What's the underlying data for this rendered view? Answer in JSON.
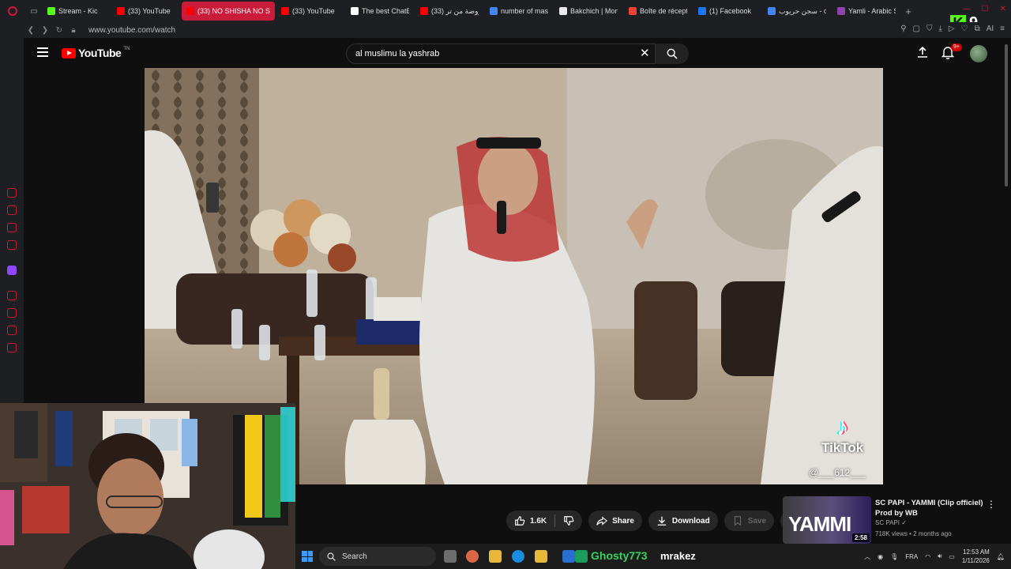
{
  "browser": {
    "tabs": [
      {
        "label": "Stream - Kic",
        "color": "#53fc18"
      },
      {
        "label": "(33) YouTube",
        "color": "#ff0000"
      },
      {
        "label": "(33) NO SHISHA NO S",
        "color": "#ff0000",
        "active": true
      },
      {
        "label": "(33) YouTube",
        "color": "#ff0000"
      },
      {
        "label": "The best ChatB",
        "color": "#ffffff"
      },
      {
        "label": "(33) روضة من تر",
        "color": "#ff0000"
      },
      {
        "label": "number of mast",
        "color": "#4285f4"
      },
      {
        "label": "Bakchich | Mon",
        "color": "#e8e8e8"
      },
      {
        "label": "Boîte de récept",
        "color": "#ea4335"
      },
      {
        "label": "(1) Facebook",
        "color": "#1877f2"
      },
      {
        "label": "سجن حريوب - ch",
        "color": "#4285f4"
      },
      {
        "label": "Yamli - Arabic S",
        "color": "#8e44ad"
      }
    ],
    "new_tab_label": "+",
    "url": "www.youtube.com/watch",
    "kick_overlay": {
      "letter": "K",
      "count": "9"
    }
  },
  "youtube": {
    "logo_text": "YouTube",
    "logo_region": "TN",
    "search_value": "al muslimu la yashrab",
    "notification_count": "9+",
    "video_overlay": {
      "brand": "TikTok",
      "handle": "@___612___"
    },
    "actions": {
      "like_count": "1.6K",
      "share_label": "Share",
      "download_label": "Download",
      "save_label": "Save"
    },
    "recommendation": {
      "thumb_text": "YAMMI",
      "duration": "2:58",
      "title": "SC PAPI - YAMMI (Clip officiel) Prod by WB",
      "channel": "SC PAPI",
      "meta": "718K views • 2 months ago"
    }
  },
  "taskbar": {
    "search_label": "Search",
    "streamer_name": "Ghosty773",
    "streamer_tag": "mrakez",
    "language": "FRA",
    "time": "12:53 AM",
    "date": "1/11/2026"
  },
  "colors": {
    "accent_red": "#ca1b3a",
    "youtube_red": "#ff0000",
    "kick_green": "#53fc18"
  }
}
